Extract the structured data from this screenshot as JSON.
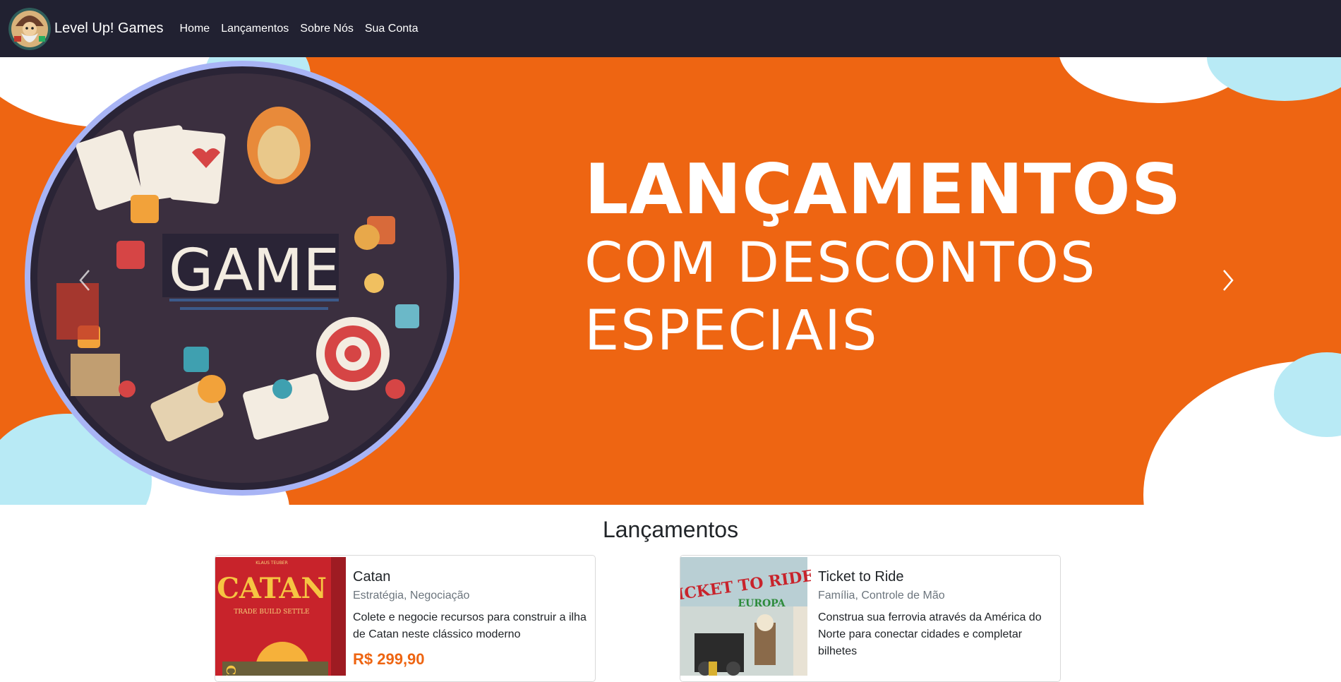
{
  "navbar": {
    "brand": "Level Up! Games",
    "logo_icon": "wizard-logo",
    "links": [
      "Home",
      "Lançamentos",
      "Sobre Nós",
      "Sua Conta"
    ]
  },
  "hero": {
    "line1": "LANÇAMENTOS",
    "line2": "COM DESCONTOS",
    "line3": "ESPECIAIS",
    "image_text": "GAME",
    "prev_icon": "chevron-left-icon",
    "next_icon": "chevron-right-icon"
  },
  "section": {
    "title": "Lançamentos"
  },
  "products": [
    {
      "title": "Catan",
      "categories": "Estratégia, Negociação",
      "description": "Colete e negocie recursos para construir a ilha de Catan neste clássico moderno",
      "price": "R$ 299,90",
      "box_title": "CATAN",
      "box_tagline": "TRADE BUILD SETTLE"
    },
    {
      "title": "Ticket to Ride",
      "categories": "Família, Controle de Mão",
      "description": "Construa sua ferrovia através da América do Norte para conectar cidades e completar bilhetes",
      "box_title": "TICKET TO RIDE",
      "box_subtitle": "EUROPA"
    }
  ],
  "colors": {
    "navbar": "#212131",
    "hero_bg": "#ee6512",
    "cloud_blue": "#b8eaf5",
    "price": "#ee6512"
  }
}
